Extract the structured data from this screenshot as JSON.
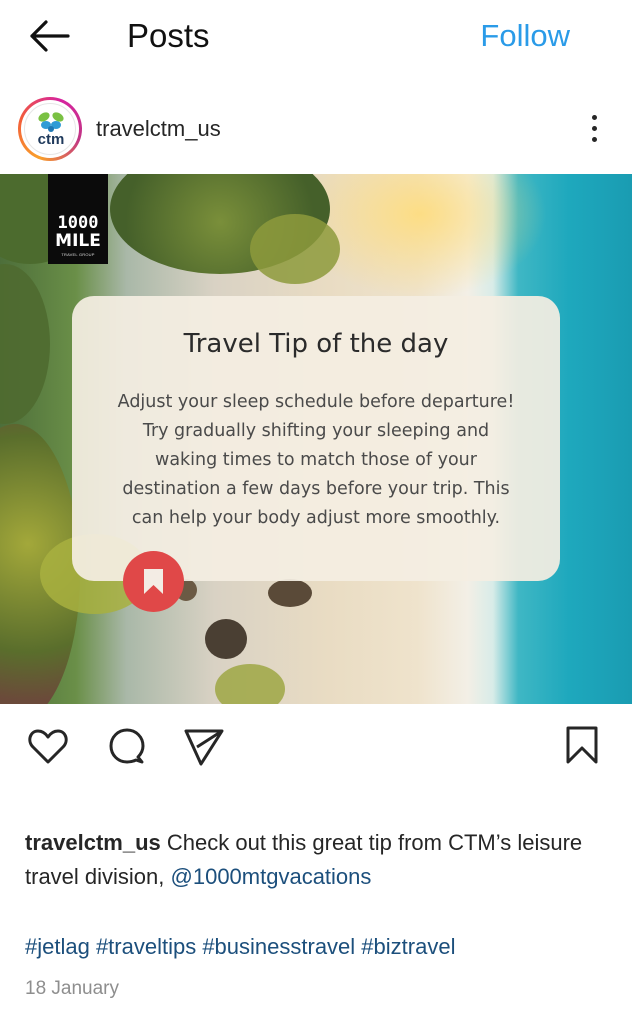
{
  "header": {
    "back_icon": "arrow-left-icon",
    "title": "Posts",
    "follow_label": "Follow",
    "follow_color": "#2a9be8"
  },
  "post": {
    "avatar_text": "ctm",
    "username": "travelctm_us",
    "more_icon": "vertical-ellipsis-icon",
    "image": {
      "brand_line1": "1000",
      "brand_line2": "MILE",
      "brand_sub": "TRAVEL GROUP",
      "tip_title": "Travel Tip of the day",
      "tip_lines": [
        "Adjust your sleep schedule before departure!",
        "Try gradually shifting your sleeping and",
        "waking times to match those of your",
        "destination a few days before your trip. This",
        "can help your body adjust more smoothly."
      ],
      "badge_icon": "bookmark-icon",
      "badge_color": "#e04848"
    },
    "actions": {
      "like_icon": "heart-icon",
      "comment_icon": "comment-icon",
      "share_icon": "send-icon",
      "save_icon": "bookmark-icon"
    },
    "caption": {
      "username": "travelctm_us",
      "text": " Check out this great tip from CTM’s leisure travel division, ",
      "mention": "@1000mtgvacations"
    },
    "hashtags": "#jetlag #traveltips #businesstravel #biztravel",
    "date": "18 January"
  }
}
